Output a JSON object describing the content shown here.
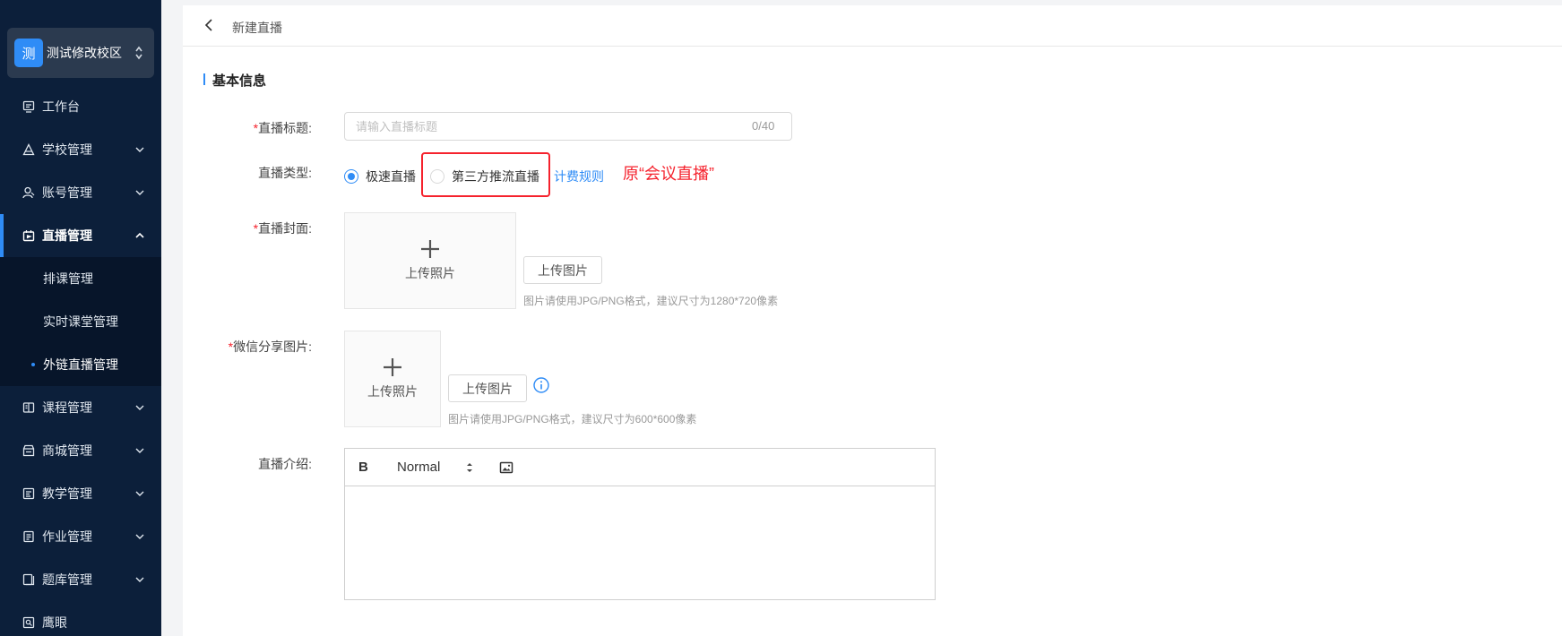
{
  "colors": {
    "sidebar_bg": "#0c1f3a",
    "accent": "#2f8cf6",
    "required": "#f5222d"
  },
  "school": {
    "logo_char": "测",
    "name": "测试修改校区"
  },
  "sidebar": {
    "items": [
      {
        "label": "工作台",
        "icon": "dashboard-icon"
      },
      {
        "label": "学校管理",
        "icon": "school-icon"
      },
      {
        "label": "账号管理",
        "icon": "account-icon"
      },
      {
        "label": "直播管理",
        "icon": "live-icon"
      },
      {
        "label": "课程管理",
        "icon": "course-icon"
      },
      {
        "label": "商城管理",
        "icon": "store-icon"
      },
      {
        "label": "教学管理",
        "icon": "teaching-icon"
      },
      {
        "label": "作业管理",
        "icon": "homework-icon"
      },
      {
        "label": "题库管理",
        "icon": "question-bank-icon"
      },
      {
        "label": "鹰眼",
        "icon": "eagle-eye-icon"
      }
    ],
    "sub_items": [
      {
        "label": "排课管理"
      },
      {
        "label": "实时课堂管理"
      },
      {
        "label": "外链直播管理"
      }
    ]
  },
  "header": {
    "title": "新建直播"
  },
  "section": {
    "title": "基本信息"
  },
  "form": {
    "title_label": "直播标题:",
    "title_placeholder": "请输入直播标题",
    "title_value": "",
    "title_counter": "0/40",
    "type_label": "直播类型:",
    "type_options": [
      {
        "label": "极速直播",
        "checked": true
      },
      {
        "label": "第三方推流直播",
        "checked": false
      }
    ],
    "billing_link": "计费规则",
    "annotation": "原“会议直播”",
    "cover_label": "直播封面:",
    "cover_upload_text": "上传照片",
    "cover_button": "上传图片",
    "cover_hint": "图片请使用JPG/PNG格式，建议尺寸为1280*720像素",
    "share_label": "微信分享图片:",
    "share_upload_text": "上传照片",
    "share_button": "上传图片",
    "share_hint": "图片请使用JPG/PNG格式，建议尺寸为600*600像素",
    "intro_label": "直播介绍:",
    "editor_bold": "B",
    "editor_format": "Normal"
  }
}
